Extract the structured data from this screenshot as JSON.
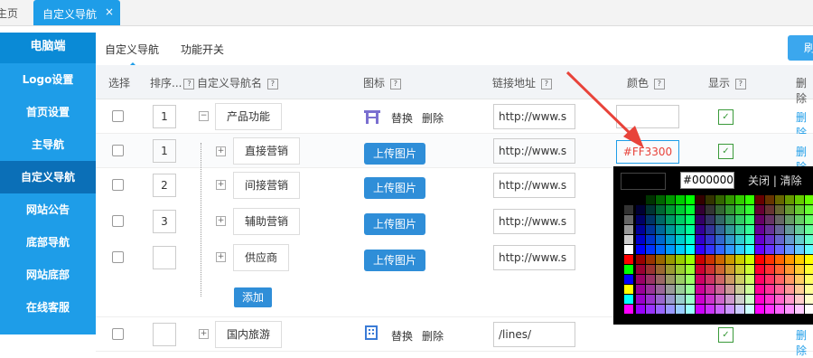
{
  "topbar": {
    "home_tab": "主页",
    "active_tab": "自定义导航",
    "close_glyph": "×"
  },
  "sidebar": {
    "header": "电脑端",
    "items": [
      {
        "label": "Logo设置",
        "active": false
      },
      {
        "label": "首页设置",
        "active": false
      },
      {
        "label": "主导航",
        "active": false
      },
      {
        "label": "自定义导航",
        "active": true
      },
      {
        "label": "网站公告",
        "active": false
      },
      {
        "label": "底部导航",
        "active": false
      },
      {
        "label": "网站底部",
        "active": false
      },
      {
        "label": "在线客服",
        "active": false
      }
    ]
  },
  "subtabs": {
    "tab1": "自定义导航",
    "tab2": "功能开关",
    "right_button": "刷"
  },
  "columns": {
    "select": "选择",
    "sort": "排序...",
    "name": "自定义导航名",
    "icon": "图标",
    "link": "链接地址",
    "color": "颜色",
    "show": "显示",
    "delete": "删除"
  },
  "rows": [
    {
      "sort": "1",
      "name": "产品功能",
      "icon_type": "image",
      "replace": "替换",
      "remove": "删除",
      "link": "http://www.s",
      "color": "",
      "del": "删除"
    },
    {
      "sort": "1",
      "name": "直接营销",
      "upload": "上传图片",
      "link": "http://www.s",
      "color": "#FF3300",
      "del": "删除"
    },
    {
      "sort": "2",
      "name": "间接营销",
      "upload": "上传图片",
      "link": "http://www.s"
    },
    {
      "sort": "3",
      "name": "辅助营销",
      "upload": "上传图片",
      "link": "http://www.s"
    },
    {
      "sort": "",
      "name": "供应商",
      "upload": "上传图片",
      "link": "http://www.s"
    },
    {
      "sort": "",
      "name": "国内旅游",
      "replace": "替换",
      "remove": "删除",
      "link": "/lines/",
      "del": "删除"
    }
  ],
  "add_button": "添加",
  "picker": {
    "hex_value": "#000000",
    "close_label": "关闭 | 清除",
    "current_color": "#000000"
  },
  "annotation": {
    "arrow_color": "#e8433a"
  },
  "accent": "#1e9de8"
}
